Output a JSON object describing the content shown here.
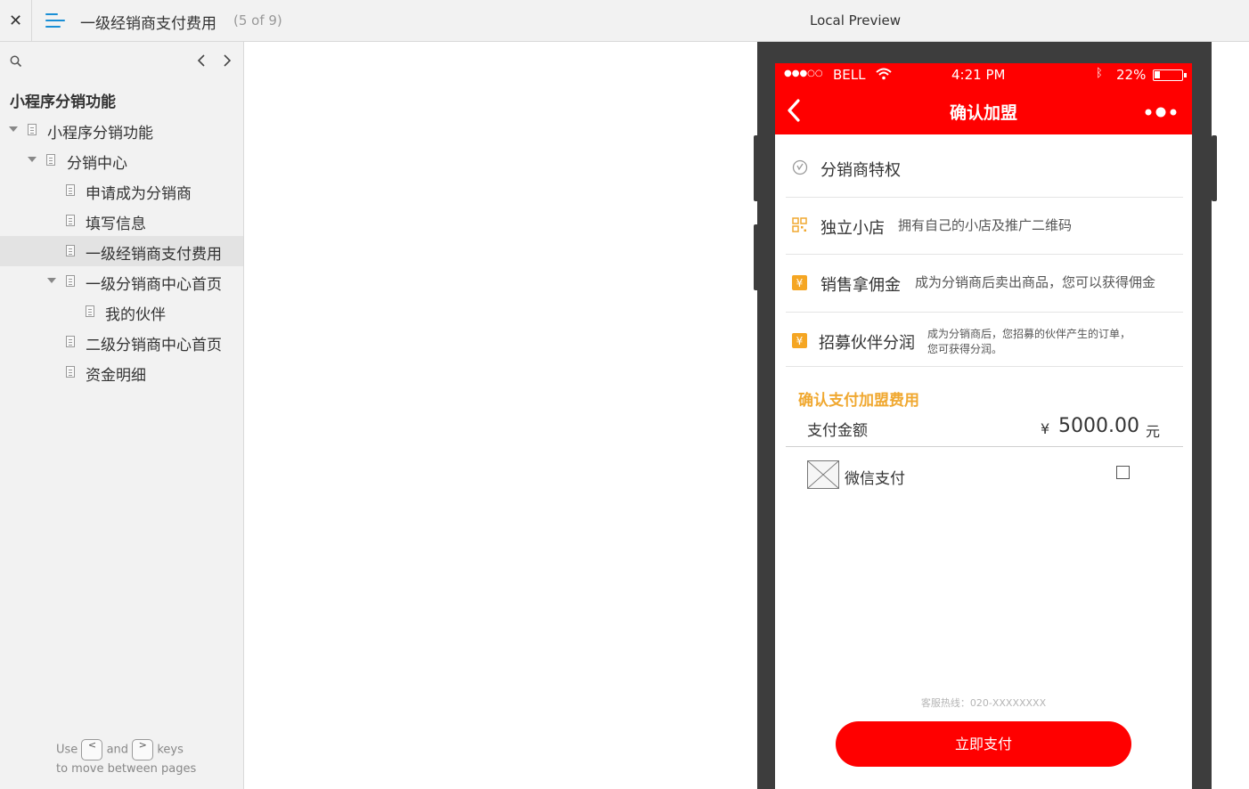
{
  "topbar": {
    "close_glyph": "✕",
    "page_title": "一级经销商支付费用",
    "page_count": "(5 of 9)",
    "preview_label": "Local Preview"
  },
  "sidebar": {
    "project_title": "小程序分销功能",
    "tree": [
      {
        "label": "小程序分销功能",
        "level": 0,
        "expanded": true
      },
      {
        "label": "分销中心",
        "level": 1,
        "expanded": true
      },
      {
        "label": "申请成为分销商",
        "level": 2
      },
      {
        "label": "填写信息",
        "level": 2
      },
      {
        "label": "一级经销商支付费用",
        "level": 2,
        "selected": true
      },
      {
        "label": "一级分销商中心首页",
        "level": 2,
        "expanded": true
      },
      {
        "label": "我的伙伴",
        "level": 3
      },
      {
        "label": "二级分销商中心首页",
        "level": 2
      },
      {
        "label": "资金明细",
        "level": 2
      }
    ],
    "hint": {
      "use": "Use",
      "and": "and",
      "keys": "keys",
      "line2": "to move between pages",
      "prev_key": "<",
      "next_key": ">"
    }
  },
  "phone": {
    "status": {
      "signal": "●●●○○",
      "carrier": "BELL",
      "time": "4:21 PM",
      "battery_pct": "22%",
      "battery_level": 0.22
    },
    "nav_title": "确认加盟",
    "privileges_header": "分销商特权",
    "privileges": [
      {
        "title": "独立小店",
        "desc": "拥有自己的小店及推广二维码",
        "icon": "qrcode-icon"
      },
      {
        "title": "销售拿佣金",
        "desc": "成为分销商后卖出商品，您可以获得佣金",
        "icon": "yen-icon"
      },
      {
        "title": "招募伙伴分润",
        "desc_line1": "成为分销商后，您招募的伙伴产生的订单，",
        "desc_line2": "您可获得分润。",
        "icon": "yen-icon"
      }
    ],
    "section_title": "确认支付加盟费用",
    "amount_label": "支付金额",
    "currency": "¥",
    "amount": "5000.00",
    "unit": "元",
    "pay_method": "微信支付",
    "hotline": "客服热线：020-XXXXXXXX",
    "pay_button": "立即支付",
    "colors": {
      "brand_red": "#ff0000",
      "accent_orange": "#f0a830"
    }
  }
}
